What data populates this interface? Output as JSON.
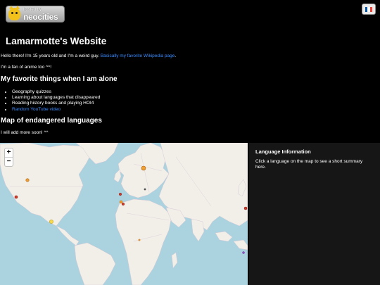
{
  "badge": {
    "small": "hosted by",
    "big": "neocities"
  },
  "language_button": {
    "flag": "flag-france-icon",
    "flag_colors": [
      "#0055a4",
      "#ffffff",
      "#ef4135"
    ]
  },
  "title": "Lamarmotte's Website",
  "intro": {
    "text": "Hello there! I'm 15 years old and I'm a weird guy. ",
    "link": "Basically my favorite Wikipedia page",
    "tail": "."
  },
  "anime": "I'm a fan of anime too ^^!",
  "things": {
    "heading": "My favorite things when I am alone",
    "items": [
      "Geography quizzes",
      "Learning about languages that disappeared",
      "Reading history books and playing HOI4"
    ],
    "link_item": "Random YouTube video"
  },
  "map_section": {
    "heading": "Map of endangered languages",
    "note": "I will add more soon! ^^"
  },
  "map": {
    "zoom_in": "+",
    "zoom_out": "−",
    "colors": {
      "water": "#aad3df",
      "land": "#f2efe9",
      "red": "#d43b2a",
      "orange": "#f0a030",
      "yellow": "#f5d94a"
    }
  },
  "info_panel": {
    "heading": "Language Information",
    "text": "Click a language on the map to see a short summary here."
  }
}
